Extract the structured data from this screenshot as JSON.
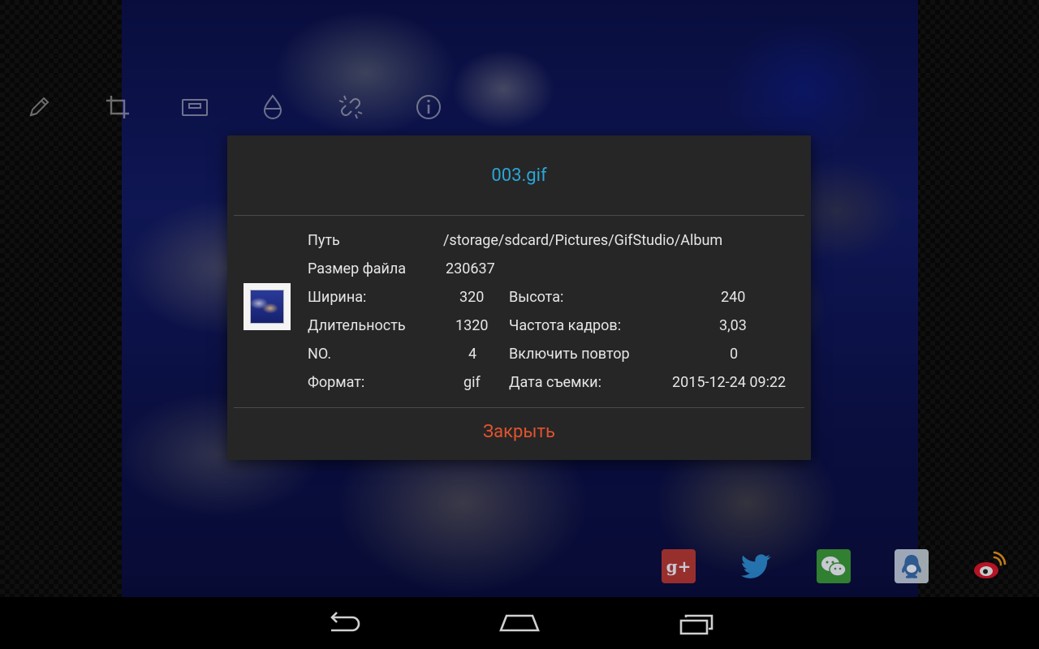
{
  "toolbar": {
    "icons": [
      "pencil-icon",
      "crop-icon",
      "frame-icon",
      "drop-icon",
      "link-broken-icon",
      "info-icon"
    ]
  },
  "dialog": {
    "title": "003.gif",
    "path_label": "Путь",
    "path_value": "/storage/sdcard/Pictures/GifStudio/Album",
    "size_label": "Размер файла",
    "size_value": "230637",
    "width_label": "Ширина:",
    "width_value": "320",
    "height_label": "Высота:",
    "height_value": "240",
    "duration_label": "Длительность",
    "duration_value": "1320",
    "fps_label": "Частота кадров:",
    "fps_value": "3,03",
    "no_label": "NO.",
    "no_value": "4",
    "loop_label": "Включить повтор",
    "loop_value": "0",
    "format_label": "Формат:",
    "format_value": "gif",
    "date_label": "Дата съемки:",
    "date_value": "2015-12-24 09:22",
    "close_label": "Закрыть"
  },
  "share": {
    "google_plus_text": "g+",
    "icons": [
      "google-plus-icon",
      "twitter-icon",
      "wechat-icon",
      "qq-icon",
      "weibo-icon"
    ]
  },
  "colors": {
    "title": "#2aa6d8",
    "close": "#e0542e",
    "dialog_bg": "#262626"
  }
}
